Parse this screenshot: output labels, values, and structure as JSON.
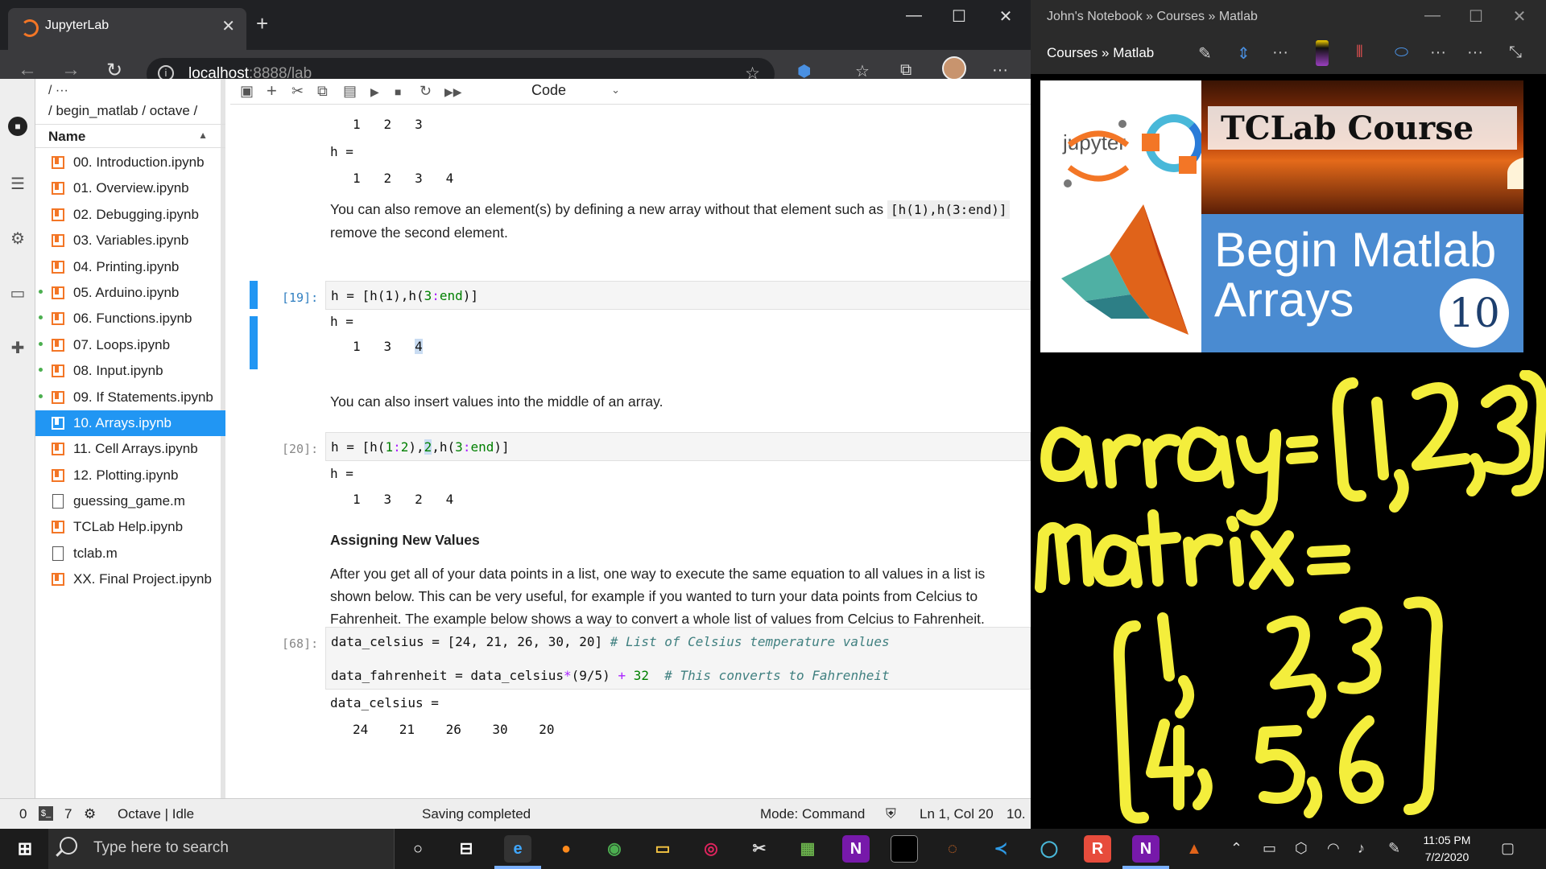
{
  "browser": {
    "tab_title": "JupyterLab",
    "url_host": "localhost",
    "url_rest": ":8888/lab"
  },
  "filebrowser": {
    "toolbar": "/  ···",
    "breadcrumb": "/ begin_matlab / octave /",
    "column_header": "Name",
    "items": [
      {
        "label": "00. Introduction.ipynb",
        "type": "notebook",
        "running": false,
        "selected": false
      },
      {
        "label": "01. Overview.ipynb",
        "type": "notebook",
        "running": false,
        "selected": false
      },
      {
        "label": "02. Debugging.ipynb",
        "type": "notebook",
        "running": false,
        "selected": false
      },
      {
        "label": "03. Variables.ipynb",
        "type": "notebook",
        "running": false,
        "selected": false
      },
      {
        "label": "04. Printing.ipynb",
        "type": "notebook",
        "running": false,
        "selected": false
      },
      {
        "label": "05. Arduino.ipynb",
        "type": "notebook",
        "running": true,
        "selected": false
      },
      {
        "label": "06. Functions.ipynb",
        "type": "notebook",
        "running": true,
        "selected": false
      },
      {
        "label": "07. Loops.ipynb",
        "type": "notebook",
        "running": true,
        "selected": false
      },
      {
        "label": "08. Input.ipynb",
        "type": "notebook",
        "running": true,
        "selected": false
      },
      {
        "label": "09. If Statements.ipynb",
        "type": "notebook",
        "running": true,
        "selected": false
      },
      {
        "label": "10. Arrays.ipynb",
        "type": "notebook",
        "running": false,
        "selected": true
      },
      {
        "label": "11. Cell Arrays.ipynb",
        "type": "notebook",
        "running": false,
        "selected": false
      },
      {
        "label": "12. Plotting.ipynb",
        "type": "notebook",
        "running": false,
        "selected": false
      },
      {
        "label": "guessing_game.m",
        "type": "file",
        "running": false,
        "selected": false
      },
      {
        "label": "TCLab Help.ipynb",
        "type": "notebook",
        "running": false,
        "selected": false
      },
      {
        "label": "tclab.m",
        "type": "file",
        "running": false,
        "selected": false
      },
      {
        "label": "XX. Final Project.ipynb",
        "type": "notebook",
        "running": false,
        "selected": false
      }
    ]
  },
  "notebook": {
    "cell_type": "Code",
    "out_top_row": "1   2   3",
    "out_h_label": "h =",
    "out_h_1234": "1   2   3   4",
    "md_remove": "You can also remove an element(s) by defining a new array without that element such as",
    "md_remove_code": "[h(1),h(3:end)]",
    "md_remove_2": "remove the second element.",
    "cell19_prompt": "[19]:",
    "cell19_code_a": "h = [h(1),h(",
    "cell19_code_b": "3",
    "cell19_code_c": ":",
    "cell19_code_d": "end",
    "cell19_code_e": ")]",
    "out19_a": "1   3",
    "out19_b": "4",
    "md_insert": "You can also insert values into the middle of an array.",
    "cell20_prompt": "[20]:",
    "cell20_code_a": "h = [h(",
    "cell20_code_b": "1",
    "cell20_code_c": ":",
    "cell20_code_d": "2",
    "cell20_code_e": "),",
    "cell20_code_f": "2",
    "cell20_code_g": ",h(",
    "cell20_code_h": "3",
    "cell20_code_i": ":",
    "cell20_code_j": "end",
    "cell20_code_k": ")]",
    "out20": "1   3   2   4",
    "heading": "Assigning New Values",
    "md_assign_1": "After you get all of your data points in a list, one way to execute the same equation to all values in a list is",
    "md_assign_2": "shown below. This can be very useful, for example if you wanted to turn your data points from Celcius to",
    "md_assign_3": "Fahrenheit. The example below shows a way to convert a whole list of values from Celcius to Fahrenheit.",
    "cell68_prompt": "[68]:",
    "cell68_line1_code": "data_celsius = [24, 21, 26, 30, 20]",
    "cell68_line1_cm": "# List of Celsius temperature values",
    "cell68_line2_code_a": "data_fahrenheit = data_celsius",
    "cell68_line2_op1": "*",
    "cell68_line2_code_b": "(9/5)",
    "cell68_line2_op2": "+",
    "cell68_line2_code_c": "32",
    "cell68_line2_cm": "# This converts to Fahrenheit",
    "out68_label": "data_celsius =",
    "out68_values": "24    21    26    30    20"
  },
  "statusbar": {
    "left_num": "0",
    "terminals": "7",
    "kernel": "Octave | Idle",
    "saving": "Saving completed",
    "mode": "Mode: Command",
    "position": "Ln 1, Col 20",
    "right_cut": "10."
  },
  "onenote": {
    "window_title": "John's Notebook » Courses » Matlab",
    "breadcrumb": "Courses » Matlab",
    "thumb_course": "TCLab Course",
    "thumb_jupyter": "jupyter",
    "thumb_line1": "Begin Matlab",
    "thumb_line2": "Arrays",
    "thumb_number": "10"
  },
  "taskbar": {
    "search_placeholder": "Type here to search",
    "time": "11:05 PM",
    "date": "7/2/2020"
  }
}
